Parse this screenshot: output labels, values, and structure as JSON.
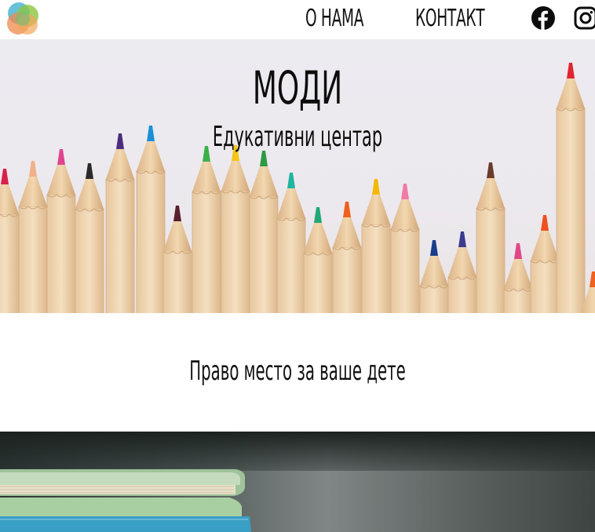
{
  "header": {
    "logo_icon": "modi-logo-icon",
    "nav": [
      {
        "label": "О НАМА"
      },
      {
        "label": "КОНТАКТ"
      }
    ],
    "social": [
      {
        "icon": "facebook-icon"
      },
      {
        "icon": "instagram-icon"
      }
    ]
  },
  "hero": {
    "title": "МОДИ",
    "subtitle": "Едукативни центар"
  },
  "tagline": "Право место за ваше дете",
  "colors": {
    "background": "#ffffff",
    "hero_background": "#ecebf0",
    "text": "#0d0d0d"
  }
}
